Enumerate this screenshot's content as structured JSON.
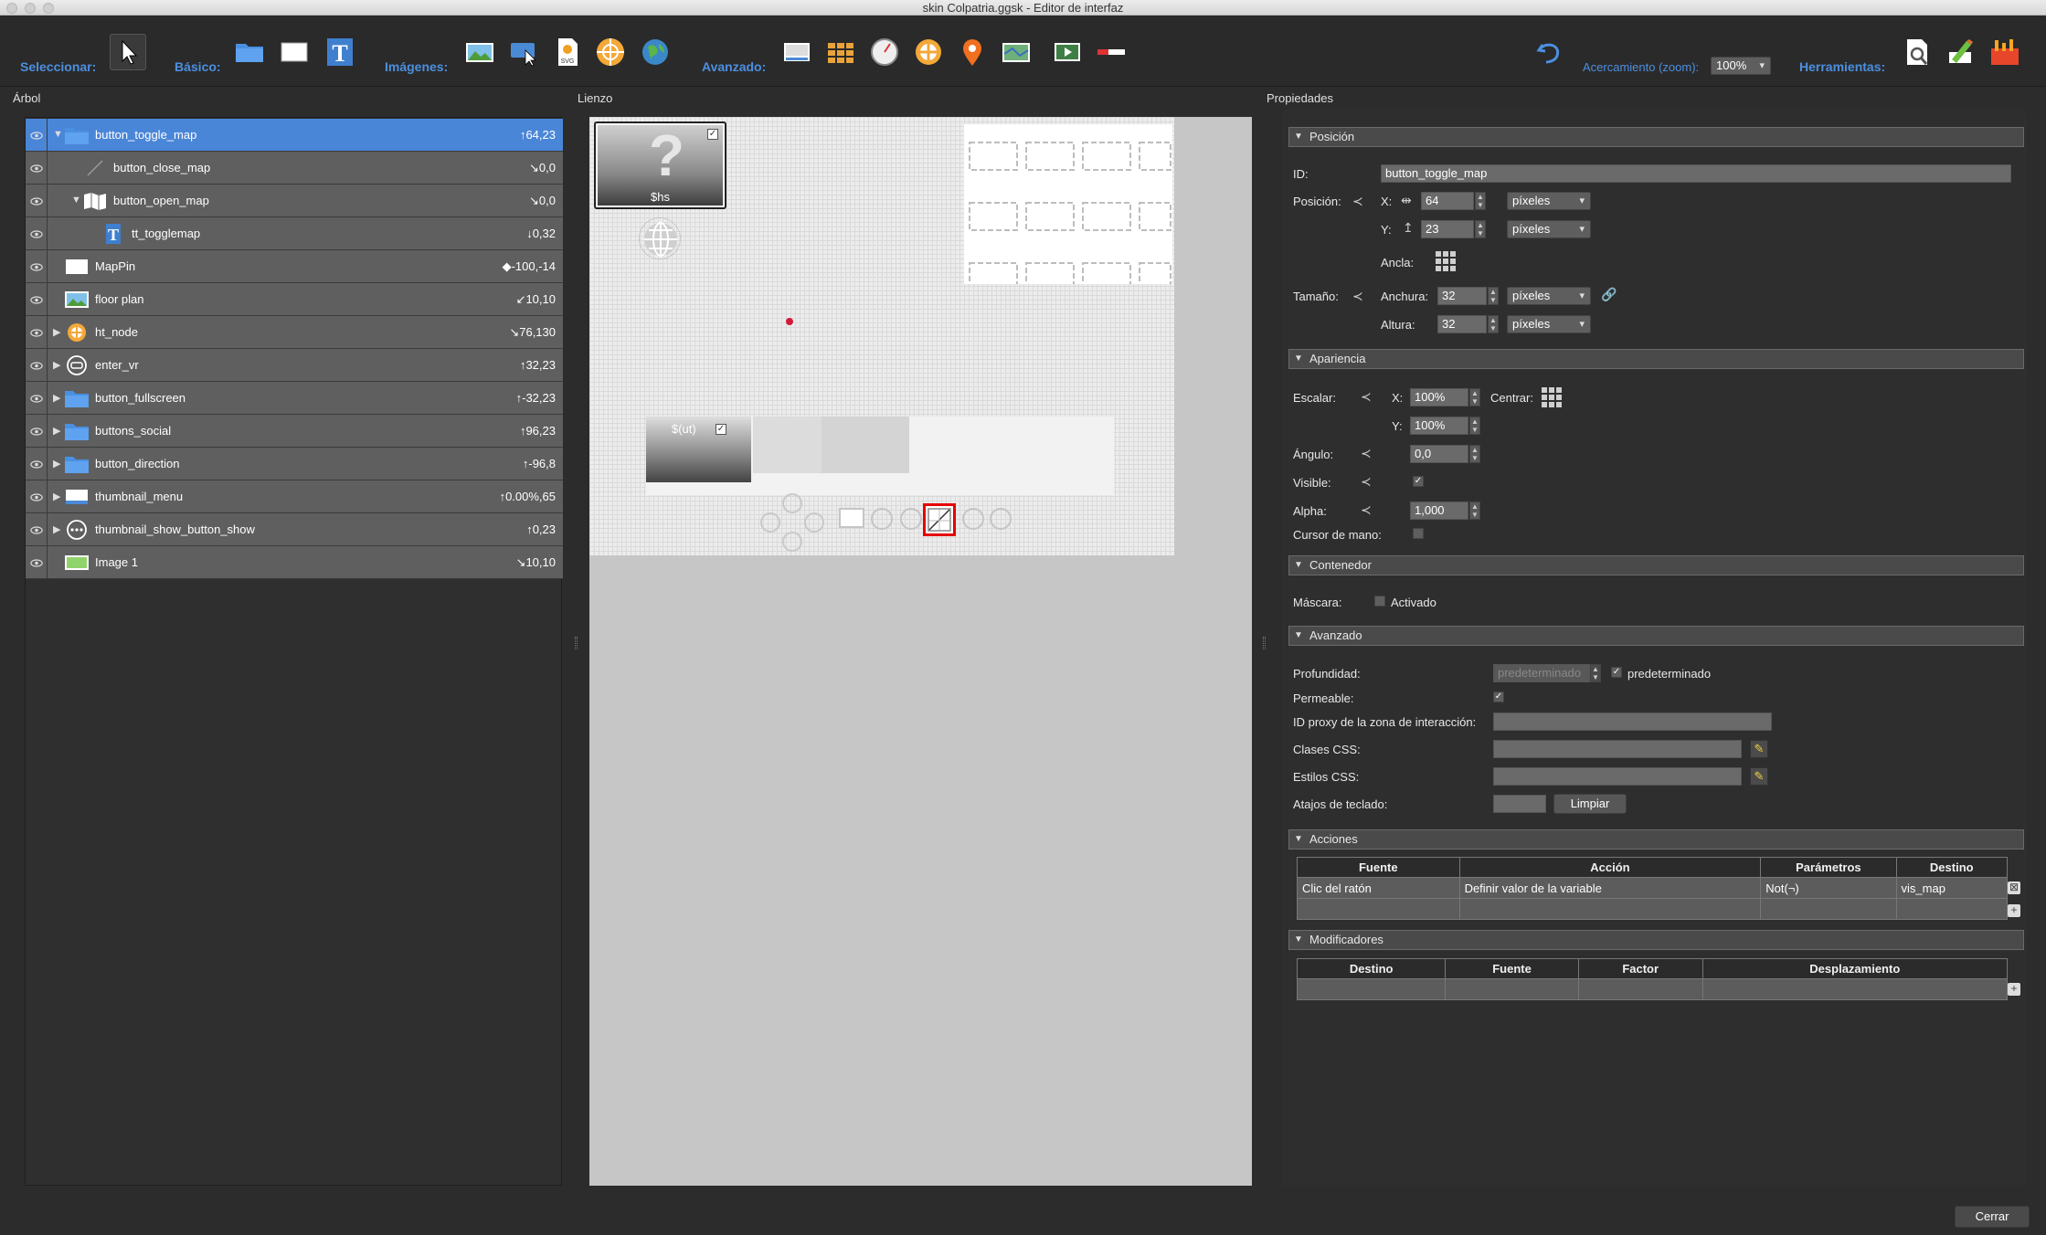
{
  "window_title": "skin Colpatria.ggsk - Editor de interfaz",
  "toolbar": {
    "select_label": "Seleccionar:",
    "basic_label": "Básico:",
    "images_label": "Imágenes:",
    "advanced_label": "Avanzado:",
    "zoom_label": "Acercamiento (zoom):",
    "zoom_value": "100%",
    "tools_label": "Herramientas:"
  },
  "panels": {
    "tree_title": "Árbol",
    "canvas_title": "Lienzo",
    "props_title": "Propiedades"
  },
  "tree": {
    "rows": [
      {
        "name": "button_toggle_map",
        "value": "↑64,23",
        "icon": "folder-icon",
        "expanded": true,
        "selected": true
      },
      {
        "name": "button_close_map",
        "value": "↘0,0",
        "icon": "line-icon"
      },
      {
        "name": "button_open_map",
        "value": "↘0,0",
        "icon": "map-icon",
        "expanded": true
      },
      {
        "name": "tt_togglemap",
        "value": "↓0,32",
        "icon": "text-icon"
      },
      {
        "name": "MapPin",
        "value": "◆-100,-14",
        "icon": "rectangle-icon"
      },
      {
        "name": "floor plan",
        "value": "↙10,10",
        "icon": "image-icon"
      },
      {
        "name": "ht_node",
        "value": "↘76,130",
        "icon": "hotspot-icon",
        "collapsed": true
      },
      {
        "name": "enter_vr",
        "value": "↑32,23",
        "icon": "vr-icon",
        "collapsed": true
      },
      {
        "name": "button_fullscreen",
        "value": "↑-32,23",
        "icon": "folder-icon",
        "collapsed": true
      },
      {
        "name": "buttons_social",
        "value": "↑96,23",
        "icon": "folder-icon",
        "collapsed": true
      },
      {
        "name": "button_direction",
        "value": "↑-96,8",
        "icon": "folder-icon",
        "collapsed": true
      },
      {
        "name": "thumbnail_menu",
        "value": "↑0.00%,65",
        "icon": "thumbnail-icon",
        "collapsed": true
      },
      {
        "name": "thumbnail_show_button_show",
        "value": "↑0,23",
        "icon": "dots-icon",
        "collapsed": true
      },
      {
        "name": "Image 1",
        "value": "↘10,10",
        "icon": "image-green-icon"
      }
    ]
  },
  "canvas": {
    "hotspot_label": "$hs",
    "ut_label": "$(ut)"
  },
  "props": {
    "position": {
      "section": "Posición",
      "id_label": "ID:",
      "id_value": "button_toggle_map",
      "pos_label": "Posición:",
      "x_label": "X:",
      "x_value": "64",
      "y_label": "Y:",
      "y_value": "23",
      "unit": "píxeles",
      "anchor_label": "Ancla:",
      "size_label": "Tamaño:",
      "width_label": "Anchura:",
      "width_value": "32",
      "height_label": "Altura:",
      "height_value": "32"
    },
    "appearance": {
      "section": "Apariencia",
      "scale_label": "Escalar:",
      "x_label": "X:",
      "scale_x": "100%",
      "y_label": "Y:",
      "scale_y": "100%",
      "center_label": "Centrar:",
      "angle_label": "Ángulo:",
      "angle_value": "0,0",
      "visible_label": "Visible:",
      "alpha_label": "Alpha:",
      "alpha_value": "1,000",
      "hand_cursor_label": "Cursor de mano:"
    },
    "container": {
      "section": "Contenedor",
      "mask_label": "Máscara:",
      "mask_option": "Activado"
    },
    "advanced": {
      "section": "Avanzado",
      "depth_label": "Profundidad:",
      "depth_placeholder": "predeterminado",
      "depth_default": "predeterminado",
      "permeable_label": "Permeable:",
      "proxy_label": "ID proxy de la zona de interacción:",
      "css_classes_label": "Clases CSS:",
      "css_styles_label": "Estilos CSS:",
      "shortcuts_label": "Atajos de teclado:",
      "clear_button": "Limpiar"
    },
    "actions": {
      "section": "Acciones",
      "columns": [
        "Fuente",
        "Acción",
        "Parámetros",
        "Destino"
      ],
      "rows": [
        [
          "Clic del ratón",
          "Definir valor de la variable",
          "Not(¬)",
          "vis_map"
        ]
      ]
    },
    "modifiers": {
      "section": "Modificadores",
      "columns": [
        "Destino",
        "Fuente",
        "Factor",
        "Desplazamiento"
      ]
    }
  },
  "footer": {
    "close_button": "Cerrar"
  }
}
